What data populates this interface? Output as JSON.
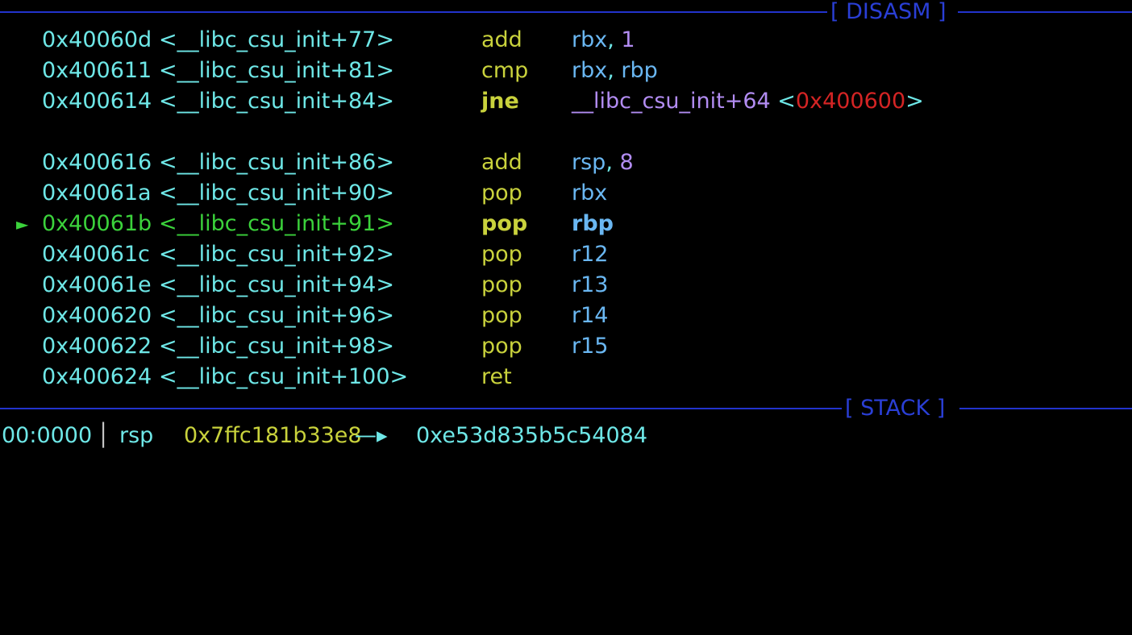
{
  "colors": {
    "background": "#000000",
    "address": "#6ee7e7",
    "current_line": "#3bd23b",
    "mnemonic": "#c9d23c",
    "register": "#6ab7f2",
    "immediate": "#b28cf2",
    "jump_target_address": "#d42424",
    "separator": "#2233cc"
  },
  "disasm": {
    "header_label": "[ DISASM ]",
    "lines": [
      {
        "address": "0x40060d",
        "symbol": "<__libc_csu_init+77>",
        "mnemonic": "add",
        "op1": "rbx",
        "sep": ", ",
        "op2": "1",
        "current": false
      },
      {
        "address": "0x400611",
        "symbol": "<__libc_csu_init+81>",
        "mnemonic": "cmp",
        "op1": "rbx",
        "sep": ", ",
        "op2": "rbp",
        "current": false
      },
      {
        "address": "0x400614",
        "symbol": "<__libc_csu_init+84>",
        "mnemonic": "jne",
        "target": "__libc_csu_init+64",
        "target_open": " <",
        "target_addr": "0x400600",
        "target_close": ">",
        "current": false
      },
      {
        "address": "0x400616",
        "symbol": "<__libc_csu_init+86>",
        "mnemonic": "add",
        "op1": "rsp",
        "sep": ", ",
        "op2": "8",
        "current": false
      },
      {
        "address": "0x40061a",
        "symbol": "<__libc_csu_init+90>",
        "mnemonic": "pop",
        "op1": "rbx",
        "current": false
      },
      {
        "marker": "►",
        "address": "0x40061b",
        "symbol": "<__libc_csu_init+91>",
        "mnemonic": "pop",
        "op1": "rbp",
        "current": true
      },
      {
        "address": "0x40061c",
        "symbol": "<__libc_csu_init+92>",
        "mnemonic": "pop",
        "op1": "r12",
        "current": false
      },
      {
        "address": "0x40061e",
        "symbol": "<__libc_csu_init+94>",
        "mnemonic": "pop",
        "op1": "r13",
        "current": false
      },
      {
        "address": "0x400620",
        "symbol": "<__libc_csu_init+96>",
        "mnemonic": "pop",
        "op1": "r14",
        "current": false
      },
      {
        "address": "0x400622",
        "symbol": "<__libc_csu_init+98>",
        "mnemonic": "pop",
        "op1": "r15",
        "current": false
      },
      {
        "address": "0x400624",
        "symbol": "<__libc_csu_init+100>",
        "mnemonic": "ret",
        "current": false
      }
    ]
  },
  "stack": {
    "header_label": "[ STACK ]",
    "first_row": {
      "index": "00:0000",
      "bar": "│",
      "reg": "rsp",
      "address": "0x7ffc181b33e8",
      "arrow": "—▸",
      "value": "0xe53d835b5c54084"
    }
  }
}
